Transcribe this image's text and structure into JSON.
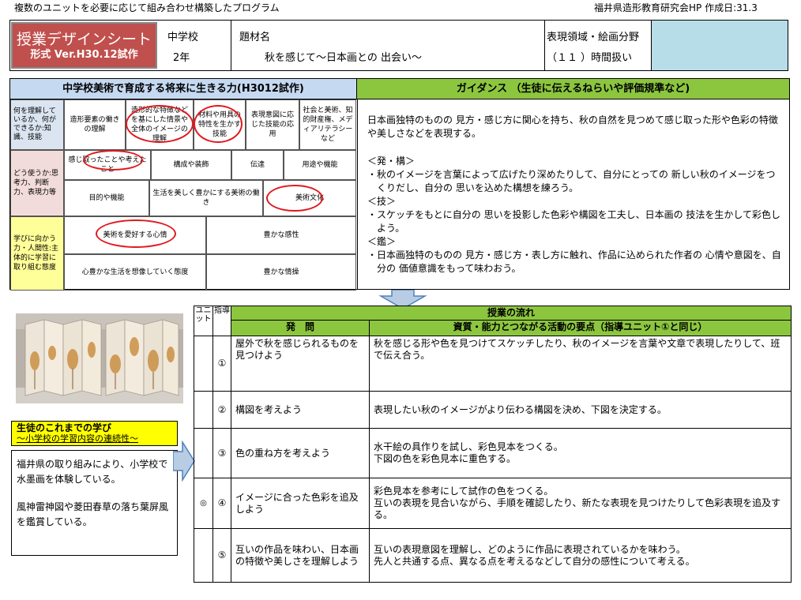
{
  "header": {
    "left": "複数のユニットを必要に応じて組み合わせ構築したプログラム",
    "right": "福井県造形教育研究会HP 作成日:31.3"
  },
  "titlebar": {
    "title": "授業デザインシート",
    "subtitle": "形式 Ver.H30.12試作",
    "school_label": "中学校",
    "grade": "2年",
    "topic_label": "題材名",
    "topic": "秋を感じて～日本画との 出会い～",
    "field_label": "表現領域・絵画分野",
    "hours": "（１１ ）時間扱い"
  },
  "abilities": {
    "heading": "中学校美術で育成する将来に生きる力(H3012試作)",
    "row1": {
      "label": "何を理解しているか、何ができるか:知識、技能",
      "items": [
        "造形要素の働きの理解",
        "造形的な特徴などを基にした情景や全体のイメージの理解",
        "材料や用具の特性を生かす技能",
        "表現意図に応じた技能の応用",
        "社会と美術、知的財産権、メディアリテラシーなど"
      ]
    },
    "row2": {
      "label": "どう使うか:思考力、判断力、表現力等",
      "items": [
        "感じ取ったことや考えたこと",
        "構成や装飾",
        "伝達",
        "用途や機能",
        "目的や機能",
        "生活を美しく豊かにする美術の働き",
        "美術文化"
      ]
    },
    "row3": {
      "label": "学びに向かう力・人間性:主体的に学習に取り組む態度",
      "items": [
        "美術を愛好する心情",
        "豊かな感性",
        "心豊かな生活を想像していく態度",
        "豊かな情操"
      ]
    }
  },
  "guidance": {
    "heading": "ガイダンス （生徒に伝えるねらいや評価規準など)",
    "intro": "日本画独特のものの 見方・感じ方に関心を持ち、秋の自然を見つめて感じ取った形や色彩の特徴や美しさなどを表現する。",
    "h1": "＜発・構＞",
    "p1": "・秋のイメージを言葉によって広げたり深めたりして、自分にとっての 新しい秋のイメージをつくりだし、自分の 思いを込めた構想を練ろう。",
    "h2": "＜技＞",
    "p2": "・スケッチをもとに自分の 思いを投影した色彩や構図を工夫し、日本画の 技法を生かして彩色しよう。",
    "h3": "＜鑑＞",
    "p3": "・日本画独特のものの 見方・感じ方・表し方に触れ、作品に込められた作者の 心情や意図を、自分の 価値意識をもって味わおう。"
  },
  "prior": {
    "heading": "生徒のこれまでの学び",
    "subheading": "～小学校の学習内容の連続性～",
    "p1": "福井県の取り組みにより、小学校で水墨画を体験している。",
    "p2": "風神雷神図や菱田春草の落ち葉屏風を鑑賞している。"
  },
  "flow": {
    "col_unit": "ユニット",
    "col_guide": "指導",
    "title": "授業の流れ",
    "col_question": "発　問",
    "col_points": "資質・能力とつながる活動の要点（指導ユニット①と同じ）",
    "rows": [
      {
        "mark": "",
        "num": "①",
        "question": "屋外で秋を感じられるものを見つけよう",
        "points": "秋を感じる形や色を見つけてスケッチしたり、秋のイメージを言葉や文章で表現したりして、班で伝え合う。"
      },
      {
        "mark": "",
        "num": "②",
        "question": "構図を考えよう",
        "points": "表現したい秋のイメージがより伝わる構図を決め、下図を決定する。"
      },
      {
        "mark": "",
        "num": "③",
        "question": "色の重ね方を考えよう",
        "points": "水干絵の具作りを試し、彩色見本をつくる。\n下図の色を彩色見本に重色する。"
      },
      {
        "mark": "◎",
        "num": "④",
        "question": "イメージに合った色彩を追及しよう",
        "points": "彩色見本を参考にして試作の色をつくる。\n互いの表現を見合いながら、手順を確認したり、新たな表現を見つけたりして色彩表現を追及する。"
      },
      {
        "mark": "",
        "num": "⑤",
        "question": "互いの作品を味わい、日本画の特徴や美しさを理解しよう",
        "points": "互いの表現意図を理解し、どのように作品に表現されているかを味わう。\n先人と共通する点、異なる点を考えるなどして自分の感性について考える。"
      }
    ]
  },
  "colors": {
    "title_bg": "#c0504d",
    "field_bg": "#b7dde8",
    "heading_blue": "#c5d9f1",
    "heading_green": "#8cc63f",
    "label1": "#dbe5f1",
    "label2": "#f2dcdb",
    "label3": "#ffff99",
    "prior_heading": "#ffff00",
    "arrow": "#b8cce4",
    "oval": "#e0191e"
  }
}
